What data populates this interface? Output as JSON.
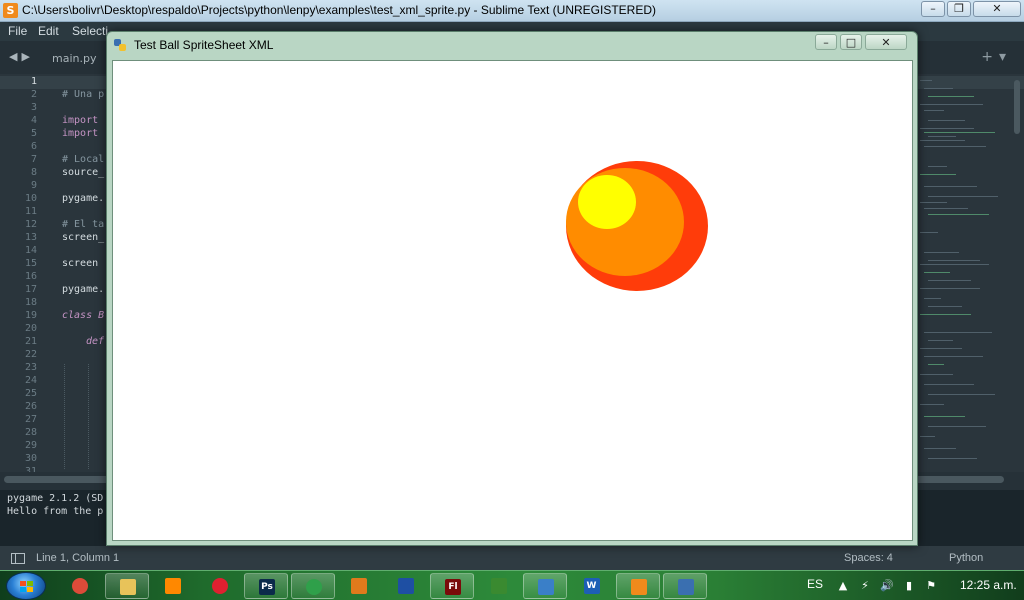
{
  "sublime": {
    "window_title": "C:\\Users\\bolivr\\Desktop\\respaldo\\Projects\\python\\lenpy\\examples\\test_xml_sprite.py - Sublime Text (UNREGISTERED)",
    "menu": [
      "File",
      "Edit",
      "Selecti"
    ],
    "tab_label": "main.py",
    "line_numbers": [
      "1",
      "2",
      "3",
      "4",
      "5",
      "6",
      "7",
      "8",
      "9",
      "10",
      "11",
      "12",
      "13",
      "14",
      "15",
      "16",
      "17",
      "18",
      "19",
      "20",
      "21",
      "22",
      "23",
      "24",
      "25",
      "26",
      "27",
      "28",
      "29",
      "30",
      "31"
    ],
    "code_lines": [
      {
        "line": 2,
        "text": "# Una p",
        "kind": "comment"
      },
      {
        "line": 4,
        "text": "import",
        "kind": "kw"
      },
      {
        "line": 5,
        "text": "import",
        "kind": "kw"
      },
      {
        "line": 7,
        "text": "# Local",
        "kind": "comment"
      },
      {
        "line": 8,
        "text": "source_",
        "kind": "plain"
      },
      {
        "line": 10,
        "text": "pygame.",
        "kind": "plain"
      },
      {
        "line": 12,
        "text": "# El ta",
        "kind": "comment"
      },
      {
        "line": 13,
        "text": "screen_",
        "kind": "plain"
      },
      {
        "line": 15,
        "text": "screen",
        "kind": "plain"
      },
      {
        "line": 17,
        "text": "pygame.",
        "kind": "plain"
      },
      {
        "line": 19,
        "text": "class B",
        "kind": "kwi"
      },
      {
        "line": 21,
        "text": "def",
        "kind": "kwi"
      }
    ],
    "console_lines": [
      "pygame 2.1.2 (SD",
      "Hello from the p"
    ],
    "status": {
      "position": "Line 1, Column 1",
      "spaces": "Spaces: 4",
      "syntax": "Python"
    }
  },
  "pygame_window": {
    "title": "Test Ball SpriteSheet XML",
    "ball_colors": {
      "outer": "#ff3c0a",
      "middle": "#ff8c00",
      "highlight": "#ffff00"
    }
  },
  "taskbar": {
    "language": "ES",
    "clock": "12:25 a.m.",
    "apps": [
      {
        "name": "chrome",
        "open": false
      },
      {
        "name": "explorer",
        "open": true
      },
      {
        "name": "vlc",
        "open": false
      },
      {
        "name": "target-app",
        "open": false
      },
      {
        "name": "photoshop",
        "label": "Ps",
        "open": true
      },
      {
        "name": "headset-app",
        "open": true
      },
      {
        "name": "fl-studio",
        "open": false
      },
      {
        "name": "blender",
        "open": false
      },
      {
        "name": "flash",
        "label": "Fl",
        "open": true
      },
      {
        "name": "wireless-app",
        "open": false
      },
      {
        "name": "keyboard-app",
        "open": true
      },
      {
        "name": "word",
        "label": "W",
        "open": false
      },
      {
        "name": "sublime-text",
        "open": true
      },
      {
        "name": "python",
        "open": true
      }
    ]
  }
}
